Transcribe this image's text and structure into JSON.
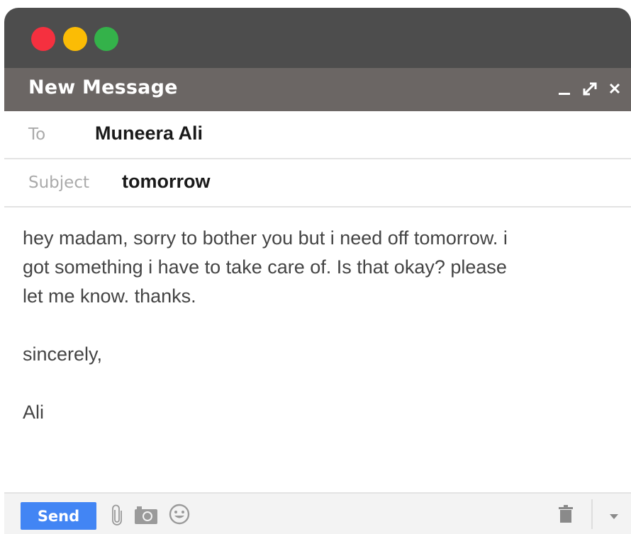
{
  "compose": {
    "header_title": "New Message",
    "to_label": "To",
    "to_value": "Muneera Ali",
    "subject_label": "Subject",
    "subject_value": "tomorrow",
    "body_lines": [
      "hey madam, sorry to bother you but i need off tomorrow. i",
      "got something i have to take care of. Is that okay? please",
      "let me know. thanks."
    ],
    "closing": "sincerely,",
    "signature": "Ali",
    "send_label": "Send"
  },
  "icons": {
    "window_controls": [
      "close-light",
      "minimize-light",
      "zoom-light"
    ],
    "header_controls": [
      "minimize-icon",
      "expand-icon",
      "close-icon"
    ],
    "footer": [
      "paperclip-icon",
      "camera-icon",
      "emoji-icon",
      "trash-icon",
      "chevron-down-icon"
    ]
  },
  "colors": {
    "titlebar": "#4d4d4d",
    "header": "#6b6664",
    "send_button": "#4285f4",
    "traffic_red": "#f5303f",
    "traffic_yellow": "#fbbc05",
    "traffic_green": "#34b24a"
  }
}
